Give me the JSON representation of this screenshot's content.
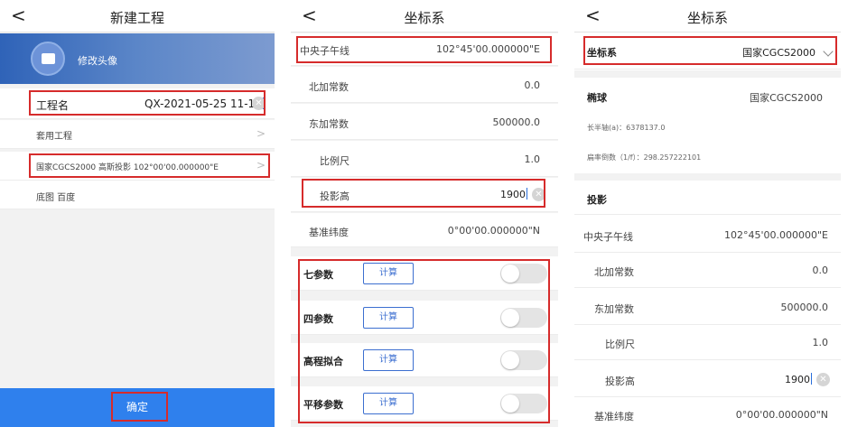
{
  "panel1": {
    "back": "<",
    "title": "新建工程",
    "avatar_label": "修改头像",
    "project_name_label": "工程名",
    "project_name_value": "QX-2021-05-25 11-15",
    "template_project": "套用工程",
    "coordinate_system": "国家CGCS2000 高斯投影 102°00'00.000000\"E",
    "basemap": "底图 百度",
    "confirm": "确定"
  },
  "panel2": {
    "back": "<",
    "title": "坐标系",
    "central_meridian_label": "中央子午线",
    "central_meridian_value": "102°45'00.000000\"E",
    "north_const_label": "北加常数",
    "north_const_value": "0.0",
    "east_const_label": "东加常数",
    "east_const_value": "500000.0",
    "scale_label": "比例尺",
    "scale_value": "1.0",
    "proj_height_label": "投影高",
    "proj_height_value": "1900",
    "base_lat_label": "基准纬度",
    "base_lat_value": "0°00'00.000000\"N",
    "params": [
      {
        "label": "七参数",
        "button": "计算"
      },
      {
        "label": "四参数",
        "button": "计算"
      },
      {
        "label": "高程拟合",
        "button": "计算"
      },
      {
        "label": "平移参数",
        "button": "计算"
      }
    ]
  },
  "panel3": {
    "back": "<",
    "title": "坐标系",
    "cs_label": "坐标系",
    "cs_value": "国家CGCS2000",
    "ellipsoid_label": "椭球",
    "ellipsoid_value": "国家CGCS2000",
    "semi_major": "长半轴(a)：6378137.0",
    "flattening": "扁率倒数（1/f）：298.257222101",
    "projection_label": "投影",
    "central_meridian_label": "中央子午线",
    "central_meridian_value": "102°45'00.000000\"E",
    "north_const_label": "北加常数",
    "north_const_value": "0.0",
    "east_const_label": "东加常数",
    "east_const_value": "500000.0",
    "scale_label": "比例尺",
    "scale_value": "1.0",
    "proj_height_label": "投影高",
    "proj_height_value": "1900",
    "base_lat_label": "基准纬度",
    "base_lat_value": "0°00'00.000000\"N"
  },
  "colors": {
    "accent_blue": "#2f80ed",
    "highlight_red": "#d62b2b",
    "banner_blue": "#3d6db5"
  }
}
